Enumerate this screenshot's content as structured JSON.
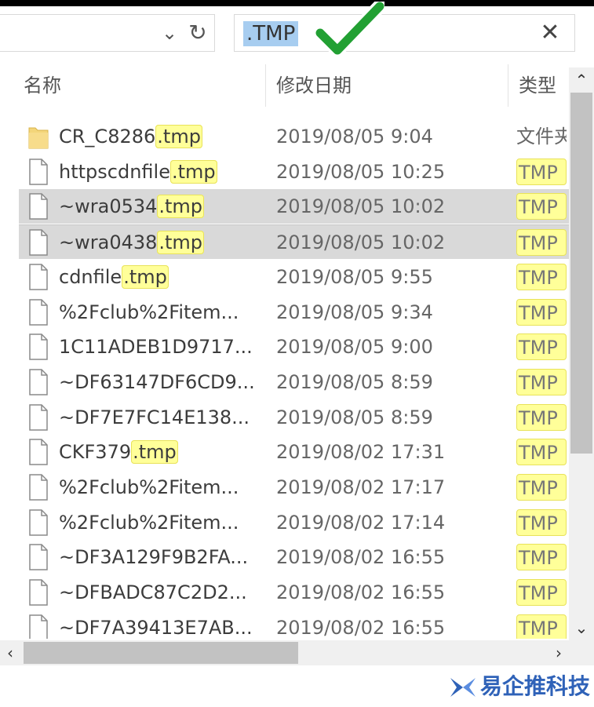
{
  "address_bar": {
    "chevron_icon": "chevron-down-icon",
    "refresh_icon": "refresh-icon"
  },
  "search": {
    "query": ".TMP",
    "clear_icon": "close-icon"
  },
  "columns": {
    "name": "名称",
    "date": "修改日期",
    "type": "类型"
  },
  "files": [
    {
      "name_pre": "CR_C8286",
      "name_hl": ".tmp",
      "date": "2019/08/05 9:04",
      "type": "文件夹",
      "type_hl": false,
      "icon": "folder-icon",
      "selected": false
    },
    {
      "name_pre": "httpscdnfile",
      "name_hl": ".tmp",
      "date": "2019/08/05 10:25",
      "type": "TMP",
      "type_hl": true,
      "icon": "file-icon",
      "selected": false
    },
    {
      "name_pre": "~wra0534",
      "name_hl": ".tmp",
      "date": "2019/08/05 10:02",
      "type": "TMP",
      "type_hl": true,
      "icon": "file-icon",
      "selected": true
    },
    {
      "name_pre": "~wra0438",
      "name_hl": ".tmp",
      "date": "2019/08/05 10:02",
      "type": "TMP",
      "type_hl": true,
      "icon": "file-icon",
      "selected": true
    },
    {
      "name_pre": "cdnfile",
      "name_hl": ".tmp",
      "date": "2019/08/05 9:55",
      "type": "TMP",
      "type_hl": true,
      "icon": "file-icon",
      "selected": false
    },
    {
      "name_pre": "%2Fclub%2Fitem...",
      "name_hl": "",
      "date": "2019/08/05 9:34",
      "type": "TMP",
      "type_hl": true,
      "icon": "file-icon",
      "selected": false
    },
    {
      "name_pre": "1C11ADEB1D9717...",
      "name_hl": "",
      "date": "2019/08/05 9:00",
      "type": "TMP",
      "type_hl": true,
      "icon": "file-icon",
      "selected": false
    },
    {
      "name_pre": "~DF63147DF6CD9...",
      "name_hl": "",
      "date": "2019/08/05 8:59",
      "type": "TMP",
      "type_hl": true,
      "icon": "file-icon",
      "selected": false
    },
    {
      "name_pre": "~DF7E7FC14E138...",
      "name_hl": "",
      "date": "2019/08/05 8:59",
      "type": "TMP",
      "type_hl": true,
      "icon": "file-icon",
      "selected": false
    },
    {
      "name_pre": "CKF379",
      "name_hl": ".tmp",
      "date": "2019/08/02 17:31",
      "type": "TMP",
      "type_hl": true,
      "icon": "file-icon",
      "selected": false
    },
    {
      "name_pre": "%2Fclub%2Fitem...",
      "name_hl": "",
      "date": "2019/08/02 17:17",
      "type": "TMP",
      "type_hl": true,
      "icon": "file-icon",
      "selected": false
    },
    {
      "name_pre": "%2Fclub%2Fitem...",
      "name_hl": "",
      "date": "2019/08/02 17:14",
      "type": "TMP",
      "type_hl": true,
      "icon": "file-icon",
      "selected": false
    },
    {
      "name_pre": "~DF3A129F9B2FA...",
      "name_hl": "",
      "date": "2019/08/02 16:55",
      "type": "TMP",
      "type_hl": true,
      "icon": "file-icon",
      "selected": false
    },
    {
      "name_pre": "~DFBADC87C2D2...",
      "name_hl": "",
      "date": "2019/08/02 16:55",
      "type": "TMP",
      "type_hl": true,
      "icon": "file-icon",
      "selected": false
    },
    {
      "name_pre": "~DF7A39413E7AB...",
      "name_hl": "",
      "date": "2019/08/02 16:55",
      "type": "TMP",
      "type_hl": true,
      "icon": "file-icon",
      "selected": false
    }
  ],
  "annotation": {
    "checkmark_icon": "checkmark-icon",
    "checkmark_color": "#22a033"
  },
  "watermark": {
    "text": "易企推科技",
    "logo_icon": "logo-icon"
  },
  "colors": {
    "highlight": "#ffff99",
    "selection": "#d9d9d9",
    "search_selection": "#a7cdf0"
  }
}
